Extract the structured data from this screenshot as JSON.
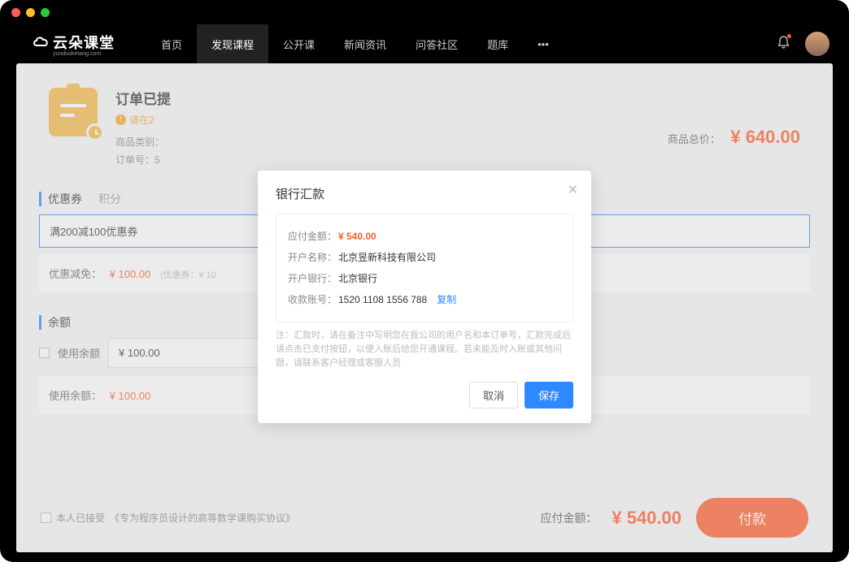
{
  "brand": {
    "name": "云朵课堂",
    "sub": "yunduoketang.com"
  },
  "nav": {
    "items": [
      "首页",
      "发现课程",
      "公开课",
      "新闻资讯",
      "问答社区",
      "题库"
    ],
    "active_index": 1,
    "more": "•••"
  },
  "order": {
    "title": "订单已提",
    "warn": "请在2",
    "line1": "商品类别：",
    "line2": "订单号：5",
    "total_label": "商品总价：",
    "total_price": "¥ 640.00"
  },
  "coupon": {
    "tab1": "优惠券",
    "tab2": "积分",
    "selected": "满200减100优惠券",
    "discount_label": "优惠减免：",
    "discount_amount": "¥ 100.00",
    "discount_note": "(优惠券：¥ 10"
  },
  "balance": {
    "title": "余额",
    "use_label": "使用余额",
    "input_value": "¥ 100.00",
    "used_label": "使用余额：",
    "used_amount": "¥ 100.00"
  },
  "footer": {
    "agree_prefix": "本人已接受",
    "agree_link": "《专为程序员设计的高等数学课购买协议》",
    "pay_label": "应付金额：",
    "pay_amount": "¥ 540.00",
    "pay_button": "付款"
  },
  "modal": {
    "title": "银行汇款",
    "rows": {
      "amount_label": "应付金额：",
      "amount_value": "¥ 540.00",
      "name_label": "开户名称：",
      "name_value": "北京昱新科技有限公司",
      "bank_label": "开户银行：",
      "bank_value": "北京银行",
      "acct_label": "收款账号：",
      "acct_value": "1520 1108 1556 788",
      "copy": "复制"
    },
    "note": "注：汇款时，请在备注中写明您在我公司的用户名和本订单号，汇款完成后请点击已支付按钮，以便入账后给您开通课程。若未能及时入账或其他问题，请联系客户经理或客服人员",
    "cancel": "取消",
    "save": "保存"
  }
}
